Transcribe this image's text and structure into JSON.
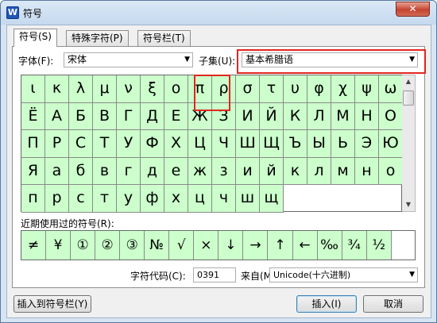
{
  "window": {
    "title": "符号",
    "app_icon": "W",
    "close_glyph": "✕"
  },
  "tabs": [
    {
      "label": "符号(S)"
    },
    {
      "label": "特殊字符(P)"
    },
    {
      "label": "符号栏(T)"
    }
  ],
  "font": {
    "label": "字体(F):",
    "value": "宋体"
  },
  "subset": {
    "label": "子集(U):",
    "value": "基本希腊语"
  },
  "grid_rows": [
    [
      "ι",
      "κ",
      "λ",
      "μ",
      "ν",
      "ξ",
      "ο",
      "π",
      "ρ",
      "σ",
      "τ",
      "υ",
      "φ",
      "χ",
      "ψ"
    ],
    [
      "ω",
      "Ё",
      "А",
      "Б",
      "В",
      "Г",
      "Д",
      "Е",
      "Ж",
      "З",
      "И",
      "Й",
      "К",
      "Л",
      "М"
    ],
    [
      "Н",
      "О",
      "П",
      "Р",
      "С",
      "Т",
      "У",
      "Ф",
      "Х",
      "Ц",
      "Ч",
      "Ш",
      "Щ",
      "Ъ",
      "Ы"
    ],
    [
      "Ь",
      "Э",
      "Ю",
      "Я",
      "а",
      "б",
      "в",
      "г",
      "д",
      "е",
      "ж",
      "з",
      "и",
      "й",
      "к"
    ],
    [
      "л",
      "м",
      "н",
      "о",
      "п",
      "р",
      "с",
      "т",
      "у",
      "ф",
      "х",
      "ц",
      "ч",
      "ш",
      "щ"
    ]
  ],
  "recent": {
    "label": "近期使用过的符号(R):",
    "symbols": [
      "≠",
      "¥",
      "①",
      "②",
      "③",
      "№",
      "√",
      "×",
      "↓",
      "→",
      "↑",
      "←",
      "‰",
      "¾",
      "½"
    ]
  },
  "char_code": {
    "label": "字符代码(C):",
    "value": "0391",
    "from_label": "来自(M)",
    "from_value": "Unicode(十六进制)"
  },
  "buttons": {
    "insert_to_bar": "插入到符号栏(Y)",
    "insert": "插入(I)",
    "cancel": "取消"
  },
  "icons": {
    "dropdown": "chevron-down-icon",
    "scroll_up": "scroll-up-icon",
    "scroll_down": "scroll-down-icon"
  },
  "colors": {
    "symbol_cell_bg": "#ccffcc",
    "highlight": "#e0271f"
  }
}
